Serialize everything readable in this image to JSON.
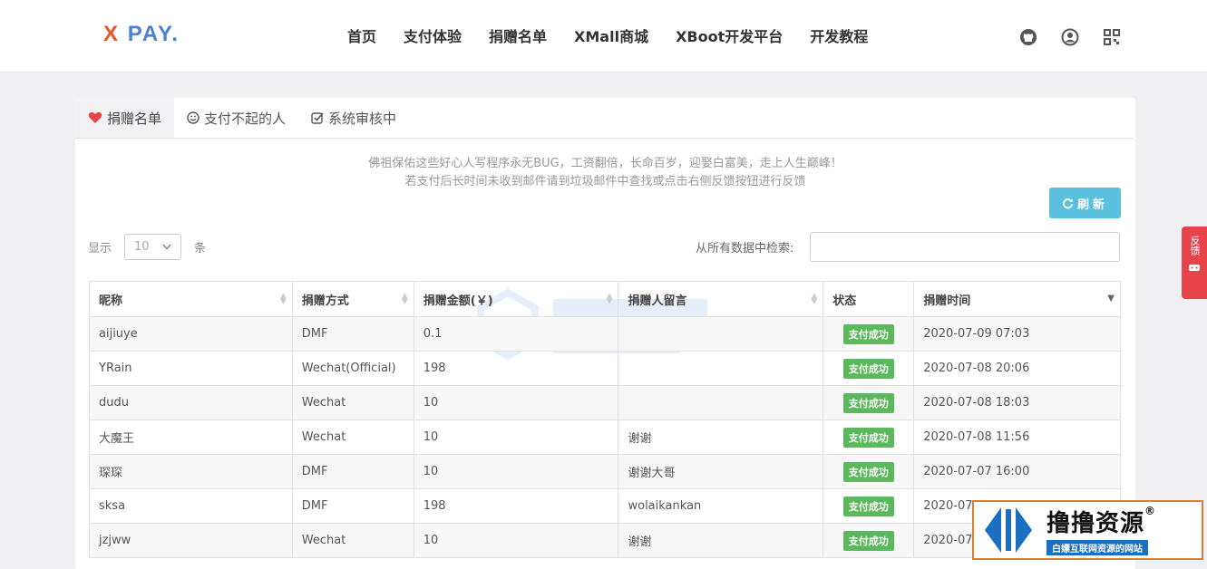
{
  "header": {
    "logo_x": "X",
    "logo_rest": "PAY.",
    "nav": [
      "首页",
      "支付体验",
      "捐赠名单",
      "XMall商城",
      "XBoot开发平台",
      "开发教程"
    ],
    "icons": [
      "github-icon",
      "user-icon",
      "qrcode-icon"
    ]
  },
  "tabs": [
    {
      "label": "捐赠名单",
      "icon": "heart-icon",
      "active": true
    },
    {
      "label": "支付不起的人",
      "icon": "smile-icon",
      "active": false
    },
    {
      "label": "系统审核中",
      "icon": "check-square-icon",
      "active": false
    }
  ],
  "notice": {
    "line1": "佛祖保佑这些好心人写程序永无BUG，工资翻倍，长命百岁，迎娶白富美，走上人生巅峰！",
    "line2": "若支付后长时间未收到邮件请到垃圾邮件中查找或点击右侧反馈按钮进行反馈"
  },
  "refresh_label": "刷新",
  "length": {
    "prefix": "显示",
    "value": "10",
    "suffix": "条"
  },
  "search": {
    "label": "从所有数据中检索:",
    "value": ""
  },
  "table": {
    "headers": [
      "昵称",
      "捐赠方式",
      "捐赠金额(￥)",
      "捐赠人留言",
      "状态",
      "捐赠时间"
    ],
    "rows": [
      [
        "aijiuye",
        "DMF",
        "0.1",
        "",
        "支付成功",
        "2020-07-09 07:03"
      ],
      [
        "YRain",
        "Wechat(Official)",
        "198",
        "",
        "支付成功",
        "2020-07-08 20:06"
      ],
      [
        "dudu",
        "Wechat",
        "10",
        "",
        "支付成功",
        "2020-07-08 18:03"
      ],
      [
        "大魔王",
        "Wechat",
        "10",
        "谢谢",
        "支付成功",
        "2020-07-08 11:56"
      ],
      [
        "琛琛",
        "DMF",
        "10",
        "谢谢大哥",
        "支付成功",
        "2020-07-07 16:00"
      ],
      [
        "sksa",
        "DMF",
        "198",
        "wolaikankan",
        "支付成功",
        "2020-07-"
      ],
      [
        "jzjww",
        "Wechat",
        "10",
        "谢谢",
        "支付成功",
        "2020-07-"
      ]
    ]
  },
  "side_feedback": "反馈",
  "corner": {
    "title": "撸撸资源",
    "reg": "®",
    "subtitle": "白嫖互联网资源的网站"
  },
  "colors": {
    "accent": "#5bc0de",
    "success": "#5cb85c",
    "feedback": "#e8434b",
    "logo_x": "#e8552d",
    "logo_rest": "#4a7fd4"
  }
}
